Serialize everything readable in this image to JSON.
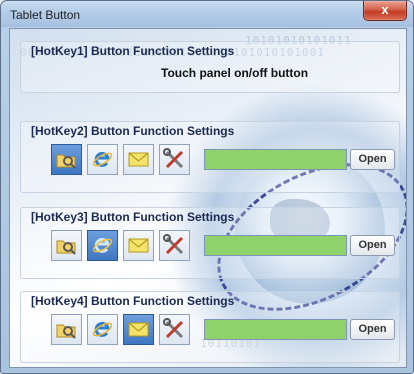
{
  "window": {
    "title": "Tablet Button",
    "close_glyph": "x"
  },
  "background": {
    "binary_rows": [
      "10101010101011",
      "0000001001001011010101101110101010101001",
      "10110101"
    ]
  },
  "groups": [
    {
      "title": "[HotKey1] Button Function Settings",
      "description": "Touch panel on/off button"
    },
    {
      "title": "[HotKey2] Button Function Settings",
      "selected_icon": "explorer-folder-icon",
      "path_value": "",
      "open_label": "Open"
    },
    {
      "title": "[HotKey3] Button Function Settings",
      "selected_icon": "internet-explorer-icon",
      "path_value": "",
      "open_label": "Open"
    },
    {
      "title": "[HotKey4] Button Function Settings",
      "selected_icon": "mail-envelope-icon",
      "path_value": "",
      "open_label": "Open"
    }
  ],
  "icons": [
    "explorer-folder-icon",
    "internet-explorer-icon",
    "mail-envelope-icon",
    "tools-icon"
  ],
  "colors": {
    "path_field": "#8fd16a",
    "selected_icon_bg": "#4a82cc",
    "close_button": "#c9442c"
  }
}
